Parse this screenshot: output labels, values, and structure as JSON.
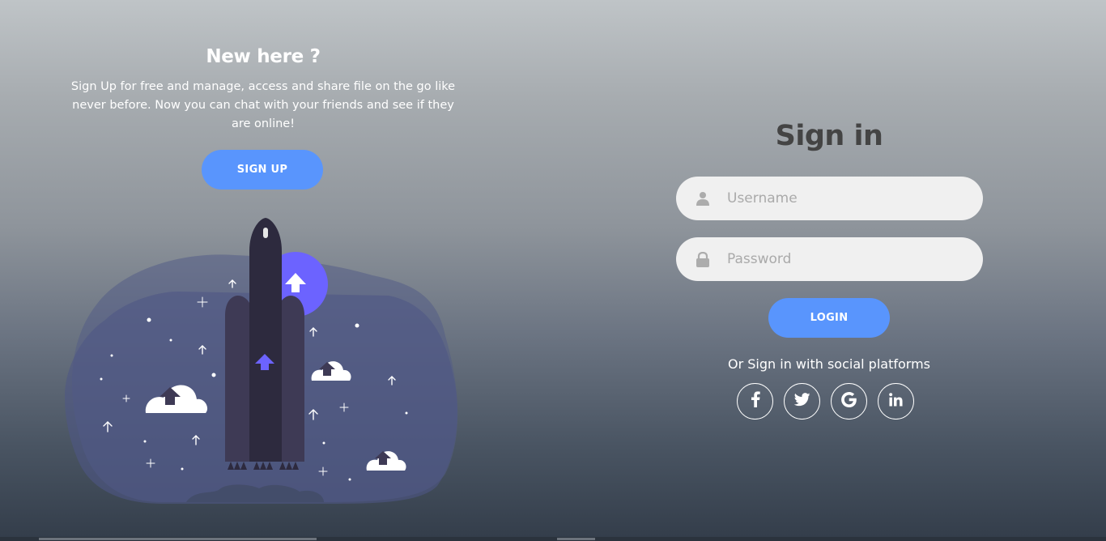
{
  "left_panel": {
    "title": "New here ?",
    "description": "Sign Up for free and manage, access and share file on the go like never before. Now you can chat with your friends and see if they are online!",
    "signup_label": "SIGN UP"
  },
  "signin": {
    "title": "Sign in",
    "username_placeholder": "Username",
    "password_placeholder": "Password",
    "login_label": "LOGIN",
    "social_text": "Or Sign in with social platforms",
    "social": [
      {
        "name": "facebook-icon",
        "glyph": "f"
      },
      {
        "name": "twitter-icon",
        "glyph": ""
      },
      {
        "name": "google-icon",
        "glyph": "G"
      },
      {
        "name": "linkedin-icon",
        "glyph": "in"
      }
    ]
  },
  "colors": {
    "accent": "#5995fd",
    "rocket_purple": "#6c63ff",
    "input_bg": "#f0f0f0",
    "heading_dark": "#444444"
  }
}
